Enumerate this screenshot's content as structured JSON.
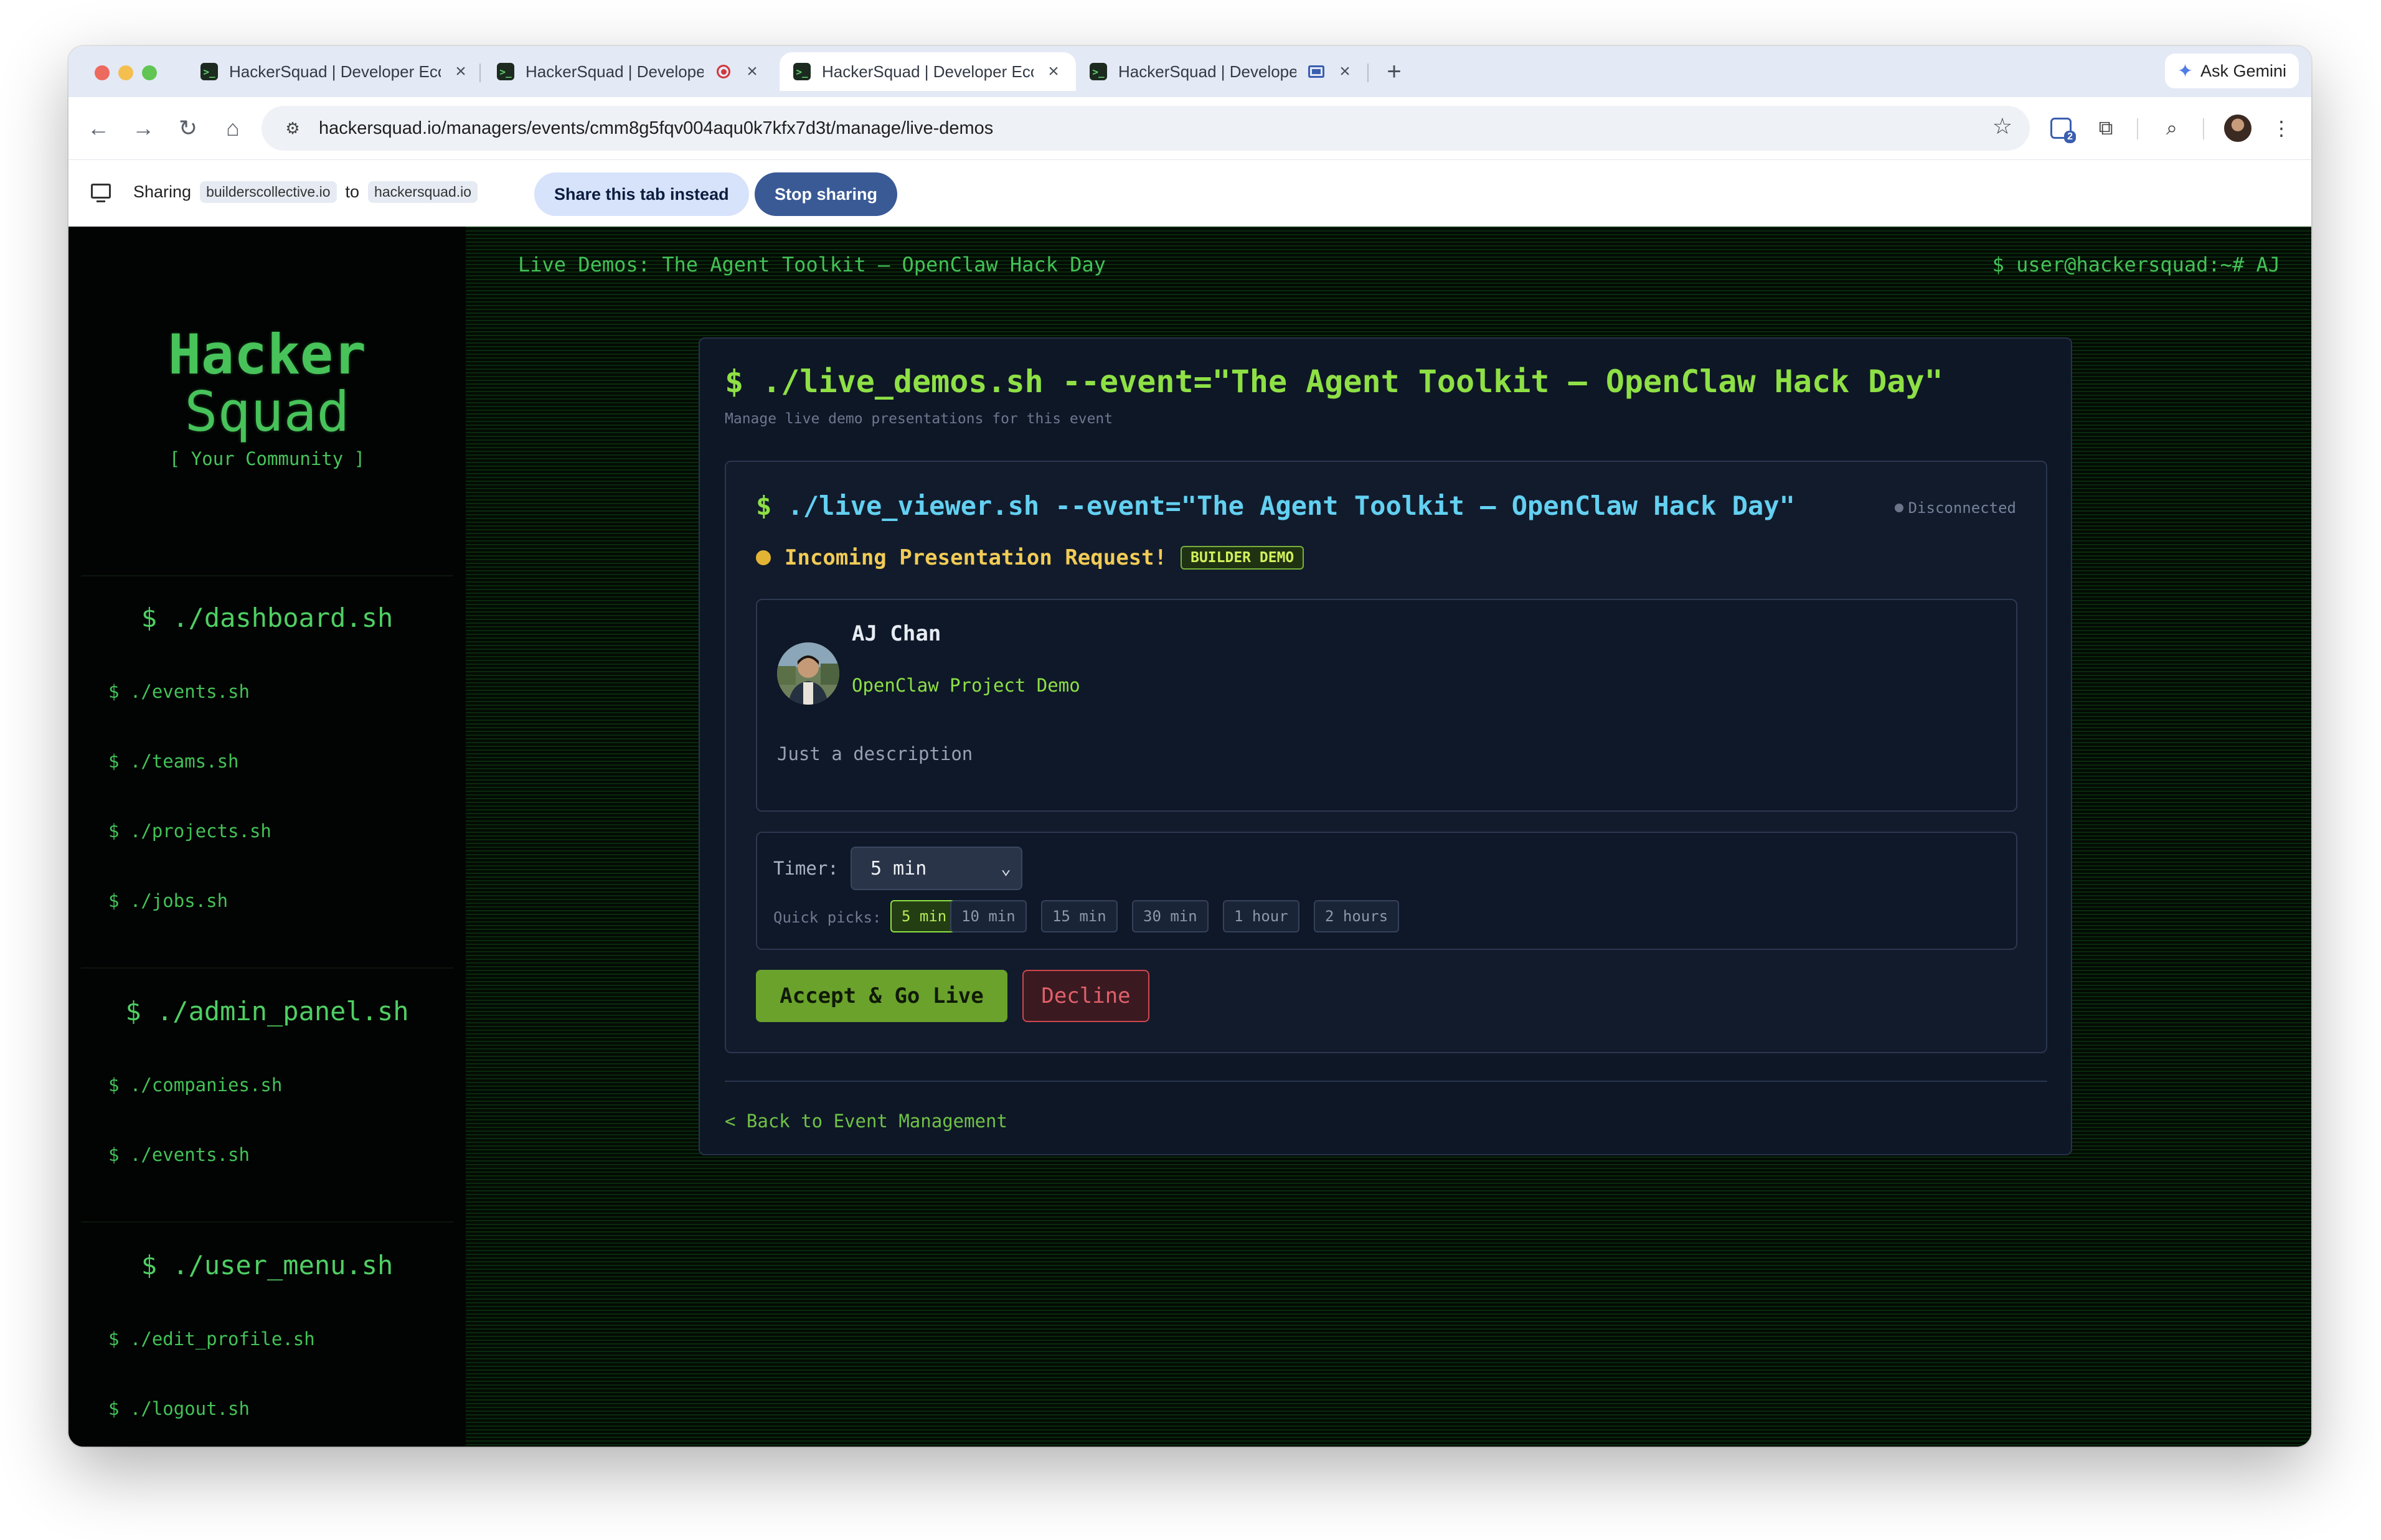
{
  "browser": {
    "tabs": [
      {
        "title": "HackerSquad | Developer Eco",
        "icon": "close-icon",
        "active": false
      },
      {
        "title": "HackerSquad | Developer",
        "icon": "recording-icon",
        "active": false
      },
      {
        "title": "HackerSquad | Developer Eco",
        "icon": "close-icon",
        "active": true
      },
      {
        "title": "HackerSquad | Developer",
        "icon": "screen-share-icon",
        "active": false
      }
    ],
    "new_tab": "+",
    "ask_gemini": "Ask Gemini",
    "url": "hackersquad.io/managers/events/cmm8g5fqv004aqu0k7kfx7d3t/manage/live-demos",
    "extension_badge": "2"
  },
  "sharing": {
    "label": "Sharing",
    "from": "builderscollective.io",
    "to_word": "to",
    "to": "hackersquad.io",
    "share_tab_button": "Share this tab instead",
    "stop_button": "Stop sharing"
  },
  "sidebar": {
    "logo_line1": "Hacker",
    "logo_line2": "Squad",
    "tagline": "[ Your Community ]",
    "sections": [
      {
        "heading": "$ ./dashboard.sh",
        "items": [
          "$ ./events.sh",
          "$ ./teams.sh",
          "$ ./projects.sh",
          "$ ./jobs.sh"
        ]
      },
      {
        "heading": "$ ./admin_panel.sh",
        "items": [
          "$ ./companies.sh",
          "$ ./events.sh"
        ]
      },
      {
        "heading": "$ ./user_menu.sh",
        "items": [
          "$ ./edit_profile.sh",
          "$ ./logout.sh"
        ]
      }
    ]
  },
  "header": {
    "title": "Live Demos: The Agent Toolkit — OpenClaw Hack Day",
    "prompt": "$ user@hackersquad:~# AJ"
  },
  "card": {
    "title": "$ ./live_demos.sh --event=\"The Agent Toolkit — OpenClaw Hack Day\"",
    "subtitle": "Manage live demo presentations for this event",
    "viewer": {
      "dollar": "$",
      "command": " ./live_viewer.sh --event=\"The Agent Toolkit — OpenClaw Hack Day\"",
      "status": "Disconnected",
      "incoming": "Incoming Presentation Request!",
      "badge": "BUILDER DEMO",
      "presenter": {
        "name": "AJ Chan",
        "project": "OpenClaw Project Demo",
        "description": "Just a description"
      },
      "timer": {
        "label": "Timer:",
        "selected": "5 min",
        "quick_label": "Quick picks:",
        "quick_picks": [
          "5 min",
          "10 min",
          "15 min",
          "30 min",
          "1 hour",
          "2 hours"
        ]
      },
      "accept_button": "Accept & Go Live",
      "decline_button": "Decline"
    },
    "back_link": "< Back to Event Management"
  }
}
